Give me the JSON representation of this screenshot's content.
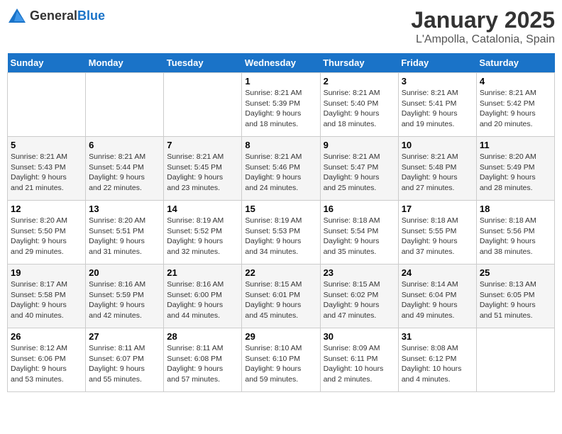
{
  "header": {
    "logo_general": "General",
    "logo_blue": "Blue",
    "title": "January 2025",
    "subtitle": "L'Ampolla, Catalonia, Spain"
  },
  "weekdays": [
    "Sunday",
    "Monday",
    "Tuesday",
    "Wednesday",
    "Thursday",
    "Friday",
    "Saturday"
  ],
  "weeks": [
    [
      {
        "day": "",
        "info": ""
      },
      {
        "day": "",
        "info": ""
      },
      {
        "day": "",
        "info": ""
      },
      {
        "day": "1",
        "info": "Sunrise: 8:21 AM\nSunset: 5:39 PM\nDaylight: 9 hours\nand 18 minutes."
      },
      {
        "day": "2",
        "info": "Sunrise: 8:21 AM\nSunset: 5:40 PM\nDaylight: 9 hours\nand 18 minutes."
      },
      {
        "day": "3",
        "info": "Sunrise: 8:21 AM\nSunset: 5:41 PM\nDaylight: 9 hours\nand 19 minutes."
      },
      {
        "day": "4",
        "info": "Sunrise: 8:21 AM\nSunset: 5:42 PM\nDaylight: 9 hours\nand 20 minutes."
      }
    ],
    [
      {
        "day": "5",
        "info": "Sunrise: 8:21 AM\nSunset: 5:43 PM\nDaylight: 9 hours\nand 21 minutes."
      },
      {
        "day": "6",
        "info": "Sunrise: 8:21 AM\nSunset: 5:44 PM\nDaylight: 9 hours\nand 22 minutes."
      },
      {
        "day": "7",
        "info": "Sunrise: 8:21 AM\nSunset: 5:45 PM\nDaylight: 9 hours\nand 23 minutes."
      },
      {
        "day": "8",
        "info": "Sunrise: 8:21 AM\nSunset: 5:46 PM\nDaylight: 9 hours\nand 24 minutes."
      },
      {
        "day": "9",
        "info": "Sunrise: 8:21 AM\nSunset: 5:47 PM\nDaylight: 9 hours\nand 25 minutes."
      },
      {
        "day": "10",
        "info": "Sunrise: 8:21 AM\nSunset: 5:48 PM\nDaylight: 9 hours\nand 27 minutes."
      },
      {
        "day": "11",
        "info": "Sunrise: 8:20 AM\nSunset: 5:49 PM\nDaylight: 9 hours\nand 28 minutes."
      }
    ],
    [
      {
        "day": "12",
        "info": "Sunrise: 8:20 AM\nSunset: 5:50 PM\nDaylight: 9 hours\nand 29 minutes."
      },
      {
        "day": "13",
        "info": "Sunrise: 8:20 AM\nSunset: 5:51 PM\nDaylight: 9 hours\nand 31 minutes."
      },
      {
        "day": "14",
        "info": "Sunrise: 8:19 AM\nSunset: 5:52 PM\nDaylight: 9 hours\nand 32 minutes."
      },
      {
        "day": "15",
        "info": "Sunrise: 8:19 AM\nSunset: 5:53 PM\nDaylight: 9 hours\nand 34 minutes."
      },
      {
        "day": "16",
        "info": "Sunrise: 8:18 AM\nSunset: 5:54 PM\nDaylight: 9 hours\nand 35 minutes."
      },
      {
        "day": "17",
        "info": "Sunrise: 8:18 AM\nSunset: 5:55 PM\nDaylight: 9 hours\nand 37 minutes."
      },
      {
        "day": "18",
        "info": "Sunrise: 8:18 AM\nSunset: 5:56 PM\nDaylight: 9 hours\nand 38 minutes."
      }
    ],
    [
      {
        "day": "19",
        "info": "Sunrise: 8:17 AM\nSunset: 5:58 PM\nDaylight: 9 hours\nand 40 minutes."
      },
      {
        "day": "20",
        "info": "Sunrise: 8:16 AM\nSunset: 5:59 PM\nDaylight: 9 hours\nand 42 minutes."
      },
      {
        "day": "21",
        "info": "Sunrise: 8:16 AM\nSunset: 6:00 PM\nDaylight: 9 hours\nand 44 minutes."
      },
      {
        "day": "22",
        "info": "Sunrise: 8:15 AM\nSunset: 6:01 PM\nDaylight: 9 hours\nand 45 minutes."
      },
      {
        "day": "23",
        "info": "Sunrise: 8:15 AM\nSunset: 6:02 PM\nDaylight: 9 hours\nand 47 minutes."
      },
      {
        "day": "24",
        "info": "Sunrise: 8:14 AM\nSunset: 6:04 PM\nDaylight: 9 hours\nand 49 minutes."
      },
      {
        "day": "25",
        "info": "Sunrise: 8:13 AM\nSunset: 6:05 PM\nDaylight: 9 hours\nand 51 minutes."
      }
    ],
    [
      {
        "day": "26",
        "info": "Sunrise: 8:12 AM\nSunset: 6:06 PM\nDaylight: 9 hours\nand 53 minutes."
      },
      {
        "day": "27",
        "info": "Sunrise: 8:11 AM\nSunset: 6:07 PM\nDaylight: 9 hours\nand 55 minutes."
      },
      {
        "day": "28",
        "info": "Sunrise: 8:11 AM\nSunset: 6:08 PM\nDaylight: 9 hours\nand 57 minutes."
      },
      {
        "day": "29",
        "info": "Sunrise: 8:10 AM\nSunset: 6:10 PM\nDaylight: 9 hours\nand 59 minutes."
      },
      {
        "day": "30",
        "info": "Sunrise: 8:09 AM\nSunset: 6:11 PM\nDaylight: 10 hours\nand 2 minutes."
      },
      {
        "day": "31",
        "info": "Sunrise: 8:08 AM\nSunset: 6:12 PM\nDaylight: 10 hours\nand 4 minutes."
      },
      {
        "day": "",
        "info": ""
      }
    ]
  ]
}
